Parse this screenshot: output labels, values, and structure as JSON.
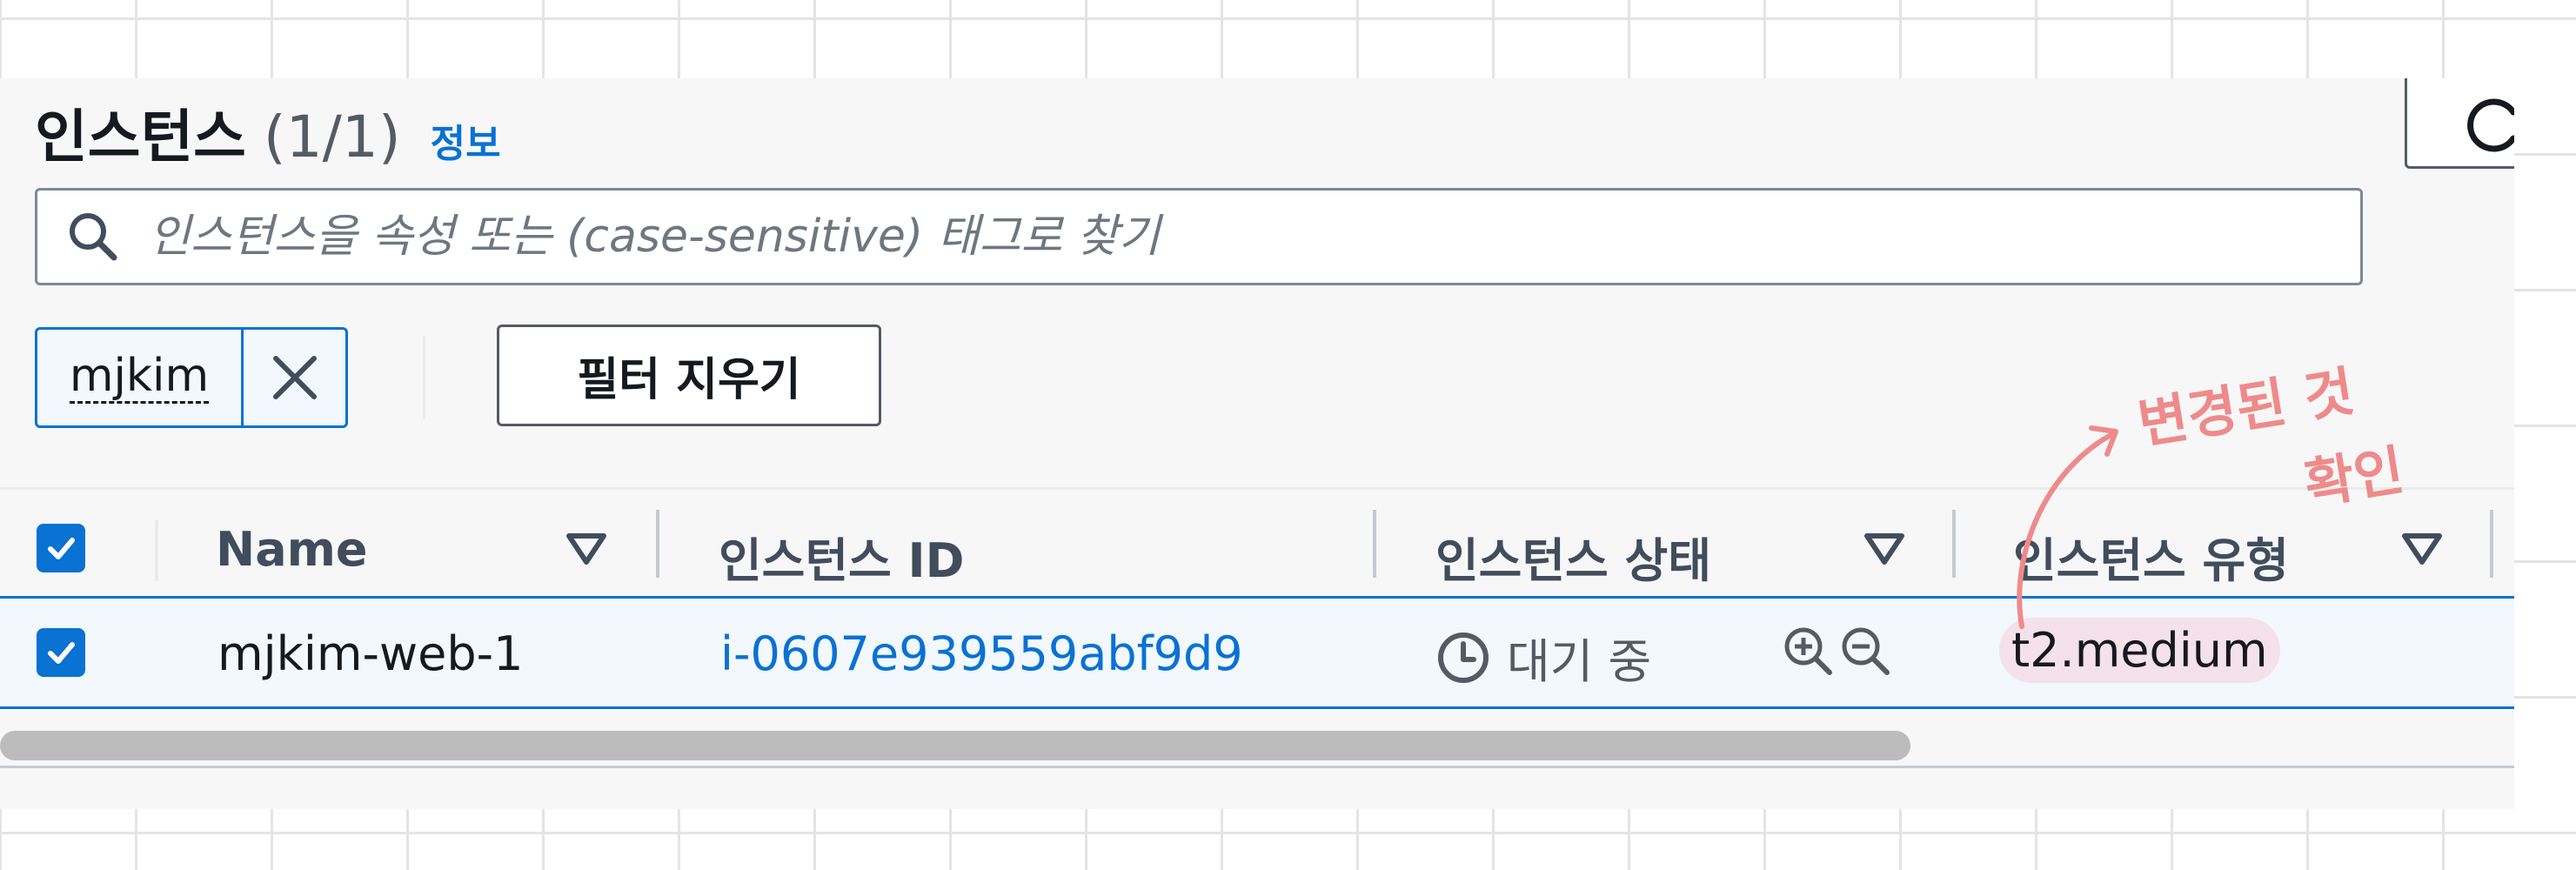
{
  "header": {
    "title": "인스턴스",
    "count": "(1/1)",
    "info_link": "정보"
  },
  "search": {
    "placeholder": "인스턴스을 속성 또는 (case-sensitive) 태그로 찾기"
  },
  "filter": {
    "token_label": "mjkim",
    "clear_button": "필터 지우기"
  },
  "table": {
    "columns": [
      {
        "label": "Name"
      },
      {
        "label": "인스턴스 ID"
      },
      {
        "label": "인스턴스 상태"
      },
      {
        "label": "인스턴스 유형"
      }
    ],
    "rows": [
      {
        "selected": true,
        "name": "mjkim-web-1",
        "instance_id": "i-0607e939559abf9d9",
        "state": "대기 중",
        "type": "t2.medium"
      }
    ]
  },
  "annotation": {
    "line1": "변경된 것",
    "line2": "확인"
  },
  "colors": {
    "accent": "#0972d3",
    "annotation": "#ef8a8a",
    "highlight": "#f5e1ea"
  },
  "icons": [
    "search-icon",
    "refresh-icon",
    "close-icon",
    "sort-icon",
    "checkbox-checked-icon",
    "clock-icon",
    "zoom-in-icon",
    "zoom-out-icon"
  ]
}
